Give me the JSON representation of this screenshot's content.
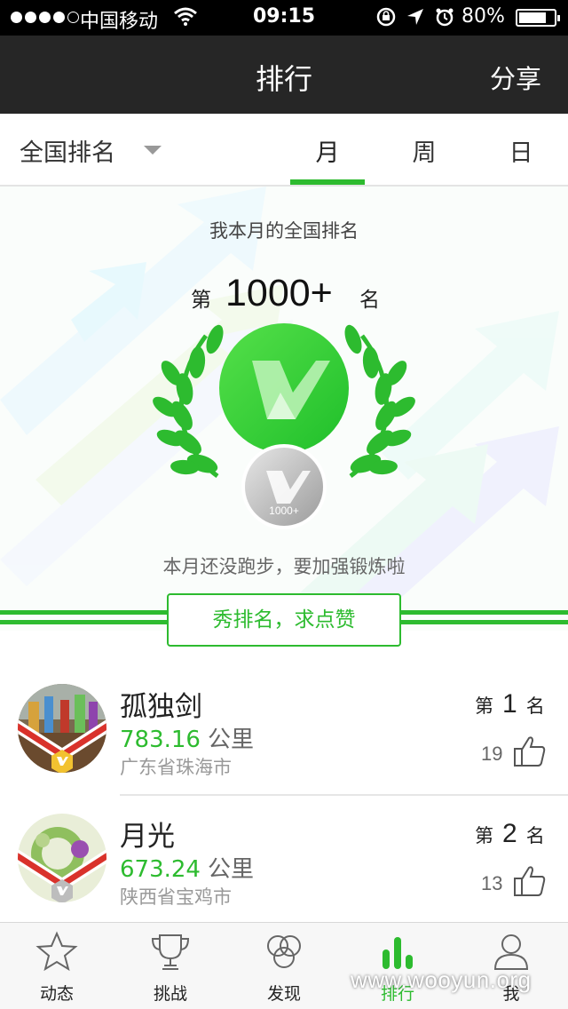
{
  "status_bar": {
    "carrier": "中国移动",
    "time": "09:15",
    "battery_percent": "80%",
    "battery_level": 0.8,
    "signal_bars_filled": 4,
    "signal_bars_total": 5
  },
  "nav": {
    "title": "排行",
    "share_label": "分享"
  },
  "filter": {
    "region_label": "全国排名",
    "tabs": [
      "月",
      "周",
      "日"
    ],
    "selected_tab": "月"
  },
  "hero": {
    "subtitle": "我本月的全国排名",
    "rank_prefix": "第",
    "rank_value": "1000+",
    "rank_suffix": "名",
    "medal_label": "1000+",
    "message": "本月还没跑步，要加强锻炼啦"
  },
  "share_button_label": "秀排名，求点赞",
  "rankings": [
    {
      "name": "孤独剑",
      "distance": "783.16",
      "unit": "公里",
      "location": "广东省珠海市",
      "rank_prefix": "第",
      "rank": "1",
      "rank_suffix": "名",
      "likes": "19",
      "medal": "gold"
    },
    {
      "name": "月光",
      "distance": "673.24",
      "unit": "公里",
      "location": "陕西省宝鸡市",
      "rank_prefix": "第",
      "rank": "2",
      "rank_suffix": "名",
      "likes": "13",
      "medal": "silver"
    }
  ],
  "tab_bar": {
    "items": [
      {
        "label": "动态",
        "icon": "star-icon"
      },
      {
        "label": "挑战",
        "icon": "trophy-icon"
      },
      {
        "label": "发现",
        "icon": "circles-icon"
      },
      {
        "label": "排行",
        "icon": "bar-chart-icon"
      },
      {
        "label": "我",
        "icon": "person-icon"
      }
    ],
    "active": "排行"
  },
  "watermark": "www.wooyun.org",
  "colors": {
    "accent_green": "#2dbb2f",
    "nav_bg": "#262626",
    "ribbon_red": "#d9322b"
  }
}
